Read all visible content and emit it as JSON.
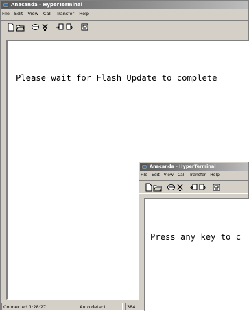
{
  "back_window": {
    "title": "Anacanda - HyperTerminal",
    "menu": [
      "File",
      "Edit",
      "View",
      "Call",
      "Transfer",
      "Help"
    ],
    "terminal_text": "Please wait for Flash Update to complete",
    "status": {
      "connected": "Connected 1:28:27",
      "detect": "Auto detect",
      "baud": "384"
    }
  },
  "front_window": {
    "title": "Anacanda - HyperTerminal",
    "menu": [
      "File",
      "Edit",
      "View",
      "Call",
      "Transfer",
      "Help"
    ],
    "terminal_text": "Press any key to c"
  },
  "icons": [
    "new-icon",
    "open-icon",
    "connect-icon",
    "disconnect-icon",
    "send-icon",
    "receive-icon",
    "properties-icon"
  ]
}
